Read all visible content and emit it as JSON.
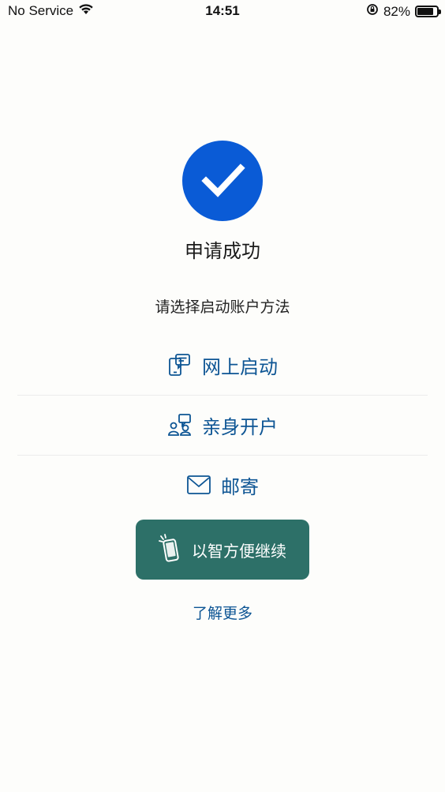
{
  "status_bar": {
    "carrier": "No Service",
    "time": "14:51",
    "battery_percent": "82%",
    "battery_level": 0.82
  },
  "result": {
    "title": "申请成功",
    "prompt": "请选择启动账户方法"
  },
  "options": [
    {
      "label": "网上启动",
      "icon": "online-activation-icon"
    },
    {
      "label": "亲身开户",
      "icon": "in-person-icon"
    },
    {
      "label": "邮寄",
      "icon": "mail-icon"
    }
  ],
  "continue_button": {
    "label": "以智方便继续",
    "icon": "iam-smart-icon"
  },
  "learn_more": "了解更多",
  "colors": {
    "primary_blue": "#0a5bd6",
    "link_blue": "#0d5594",
    "button_green": "#2d7068"
  }
}
